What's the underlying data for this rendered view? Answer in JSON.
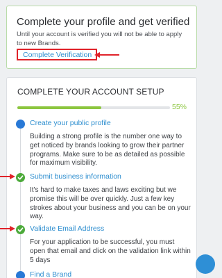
{
  "verify": {
    "title": "Complete your profile and get verified",
    "text": "Until your account is verified you will not be able to apply to new Brands.",
    "link_label": "Complete Verification"
  },
  "setup": {
    "title": "COMPLETE YOUR ACCOUNT SETUP",
    "progress_percent": 55,
    "progress_label": "55%",
    "steps": [
      {
        "title": "Create your public profile",
        "desc": "Building a strong profile is the number one way to get noticed by brands looking to grow their partner programs. Make sure to be as detailed as possible for maximum visibility.",
        "completed": false
      },
      {
        "title": "Submit business information",
        "desc": "It's hard to make taxes and laws exciting but we promise this will be over quickly. Just a few key strokes about your business and you can be on your way.",
        "completed": true
      },
      {
        "title": "Validate Email Address",
        "desc": "For your application to be successful, you must open that email and click on the validation link within 5 days",
        "completed": true
      },
      {
        "title": "Find a Brand",
        "desc": "",
        "completed": false
      }
    ]
  },
  "colors": {
    "link": "#2d8ecf",
    "progress": "#8cc63f",
    "check": "#4caa3a",
    "dot": "#2979d6",
    "annotation": "#e0232a"
  }
}
